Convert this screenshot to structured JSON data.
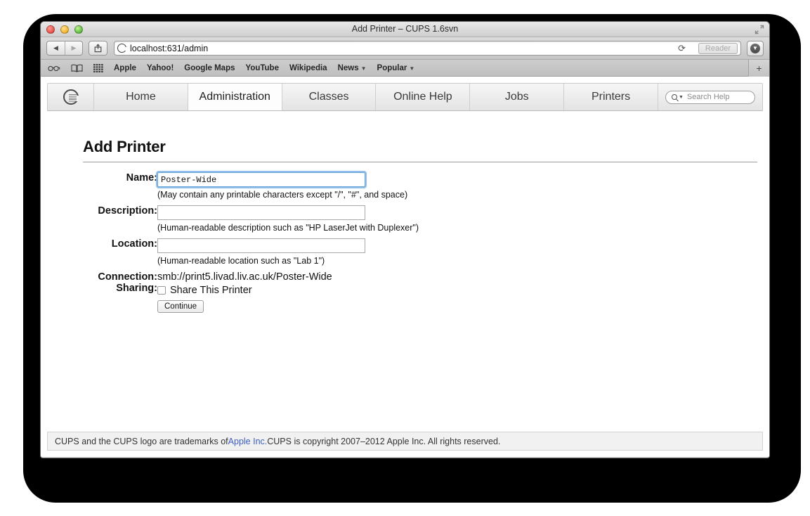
{
  "window": {
    "title": "Add Printer – CUPS 1.6svn",
    "traffic_lights": [
      "close",
      "minimize",
      "zoom"
    ],
    "fullscreen_icon": "fullscreen-arrows-icon"
  },
  "toolbar": {
    "back_label": "◀",
    "forward_label": "▶",
    "share_icon": "share-icon",
    "url_host": "localhost:631",
    "url_path": "/admin",
    "favicon": "cups-favicon",
    "reload_label": "⟳",
    "reader_label": "Reader",
    "downloads_icon": "downloads-icon"
  },
  "bookmarks": {
    "icons": [
      "reading-glasses-icon",
      "bookmarks-book-icon",
      "top-sites-grid-icon"
    ],
    "items": [
      {
        "label": "Apple",
        "menu": false
      },
      {
        "label": "Yahoo!",
        "menu": false
      },
      {
        "label": "Google Maps",
        "menu": false
      },
      {
        "label": "YouTube",
        "menu": false
      },
      {
        "label": "Wikipedia",
        "menu": false
      },
      {
        "label": "News",
        "menu": true
      },
      {
        "label": "Popular",
        "menu": true
      }
    ],
    "new_tab_label": "+"
  },
  "cups_nav": {
    "logo": "cups-logo-icon",
    "tabs": [
      {
        "label": "Home",
        "active": false
      },
      {
        "label": "Administration",
        "active": true
      },
      {
        "label": "Classes",
        "active": false
      },
      {
        "label": "Online Help",
        "active": false
      },
      {
        "label": "Jobs",
        "active": false
      },
      {
        "label": "Printers",
        "active": false
      }
    ],
    "search_placeholder": "Search Help"
  },
  "form": {
    "heading": "Add Printer",
    "fields": {
      "name_label": "Name:",
      "name_value": "Poster-Wide",
      "name_hint": "(May contain any printable characters except \"/\", \"#\", and space)",
      "description_label": "Description:",
      "description_value": "",
      "description_hint": "(Human-readable description such as \"HP LaserJet with Duplexer\")",
      "location_label": "Location:",
      "location_value": "",
      "location_hint": "(Human-readable location such as \"Lab 1\")",
      "connection_label": "Connection:",
      "connection_value": "smb://print5.livad.liv.ac.uk/Poster-Wide",
      "sharing_label": "Sharing:",
      "share_checkbox_label": "Share This Printer",
      "share_checked": false
    },
    "continue_label": "Continue"
  },
  "footer": {
    "text_before": "CUPS and the CUPS logo are trademarks of ",
    "link": "Apple Inc.",
    "text_after": " CUPS is copyright 2007–2012 Apple Inc. All rights reserved."
  },
  "colors": {
    "accent_focus": "#6aa5d8",
    "link": "#3b5fbf",
    "backdrop": "#000000"
  }
}
